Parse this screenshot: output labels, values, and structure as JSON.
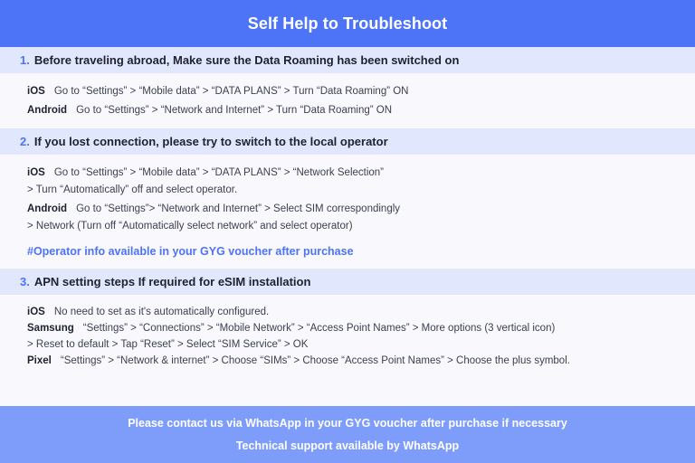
{
  "header": {
    "title": "Self Help to Troubleshoot",
    "bg_color": "#4d73f7",
    "text_color": "#ffffff"
  },
  "theme": {
    "accent_blue": "#4d73f7",
    "band_bg": "#e1e7fd",
    "page_bg": "#f8f8fd",
    "footer_bg": "#7e9cfa",
    "heading_text": "#1e2230",
    "body_text": "#3c4050"
  },
  "sections": [
    {
      "number": "1.",
      "title": "Before traveling abroad, Make sure the Data Roaming has been switched on",
      "rows": [
        {
          "platform": "iOS",
          "steps": "Go to “Settings” > “Mobile data” > “DATA PLANS” > Turn “Data Roaming” ON"
        },
        {
          "platform": "Android",
          "steps": "Go to “Settings” > “Network and Internet” > Turn “Data Roaming” ON"
        }
      ]
    },
    {
      "number": "2.",
      "title": "If you lost connection, please try to switch to the local operator",
      "rows": [
        {
          "platform": "iOS",
          "steps": "Go to “Settings” > “Mobile data” > “DATA PLANS” > “Network Selection”",
          "continuation": "> Turn “Automatically” off and select operator."
        },
        {
          "platform": "Android",
          "steps": "Go to “Settings”>  “Network and Internet” > Select SIM correspondingly",
          "continuation": "> Network (Turn off “Automatically select network” and select operator)"
        }
      ],
      "note": "#Operator info available in your GYG voucher after purchase"
    },
    {
      "number": "3.",
      "title": "APN setting steps If required for eSIM installation",
      "rows": [
        {
          "platform": "iOS",
          "steps": "No need to set as it's automatically configured."
        },
        {
          "platform": "Samsung",
          "steps": "“Settings” > “Connections” > “Mobile Network” > “Access Point Names” > More options (3 vertical icon)",
          "continuation": "> Reset to default > Tap “Reset” > Select “SIM Service” > OK"
        },
        {
          "platform": "Pixel",
          "steps": "“Settings” > “Network & internet” > Choose “SIMs” > Choose “Access Point Names” > Choose the plus symbol."
        }
      ]
    }
  ],
  "footer": {
    "line1": "Please contact us via WhatsApp  in your GYG voucher after purchase if necessary",
    "line2": "Technical support available by WhatsApp"
  }
}
